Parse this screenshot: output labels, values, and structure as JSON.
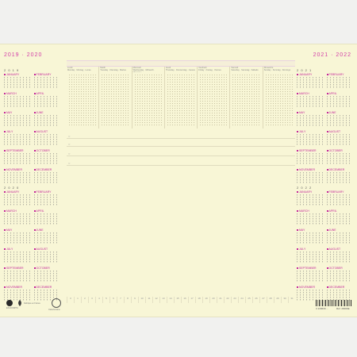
{
  "header": {
    "left_years": "2019 · 2020",
    "right_years": "2021 · 2022"
  },
  "left_blocks": [
    {
      "year_mark": "2 0 1 9",
      "months": [
        "JANUARY",
        "FEBRUARY",
        "MARCH",
        "APRIL",
        "MAY",
        "JUNE",
        "JULY",
        "AUGUST",
        "SEPTEMBER",
        "OCTOBER",
        "NOVEMBER",
        "DECEMBER"
      ]
    },
    {
      "year_mark": "2 0 2 0",
      "months": [
        "JANUARY",
        "FEBRUARY",
        "MARCH",
        "APRIL",
        "MAY",
        "JUNE",
        "JULY",
        "AUGUST",
        "SEPTEMBER",
        "OCTOBER",
        "NOVEMBER",
        "DECEMBER"
      ]
    }
  ],
  "right_blocks": [
    {
      "year_mark": "2 0 2 1",
      "months": [
        "JANUARY",
        "FEBRUARY",
        "MARCH",
        "APRIL",
        "MAY",
        "JUNE",
        "JULY",
        "AUGUST",
        "SEPTEMBER",
        "OCTOBER",
        "NOVEMBER",
        "DECEMBER"
      ]
    },
    {
      "year_mark": "2 0 2 2",
      "months": [
        "JANUARY",
        "FEBRUARY",
        "MARCH",
        "APRIL",
        "MAY",
        "JUNE",
        "JULY",
        "AUGUST",
        "SEPTEMBER",
        "OCTOBER",
        "NOVEMBER",
        "DECEMBER"
      ]
    }
  ],
  "week": {
    "days": [
      {
        "name": "Lundi",
        "sub": "Monday · Montag · Lunes"
      },
      {
        "name": "Mardi",
        "sub": "Tuesday · Dienstag · Martes"
      },
      {
        "name": "Mercredi",
        "sub": "Wednesday · Mittwoch · Miércoles"
      },
      {
        "name": "Jeudi",
        "sub": "Thursday · Donnerstag · Jueves"
      },
      {
        "name": "Vendredi",
        "sub": "Friday · Freitag · Viernes"
      },
      {
        "name": "Samedi",
        "sub": "Saturday · Samstag · Sábado"
      },
      {
        "name": "Dimanche",
        "sub": "Sunday · Sonntag · Domingo"
      }
    ]
  },
  "notes": {
    "bullets": [
      "○",
      "○",
      "○",
      "○"
    ]
  },
  "ruler": [
    "0",
    "1",
    "2",
    "3",
    "4",
    "5",
    "6",
    "7",
    "8",
    "9",
    "10",
    "11",
    "12",
    "13",
    "14",
    "15",
    "16",
    "17",
    "18",
    "19",
    "20",
    "21",
    "22",
    "23",
    "24",
    "25",
    "26",
    "27",
    "28",
    "29",
    "30",
    "31"
  ],
  "footer": {
    "logo_text_1": "EXACOMPTA",
    "logo_text_2": "Fabriqué en France",
    "logo_text_3": "Clairefontaine",
    "barcode_text": "3 130630 …",
    "ref_text": "Réf. 29000E"
  }
}
